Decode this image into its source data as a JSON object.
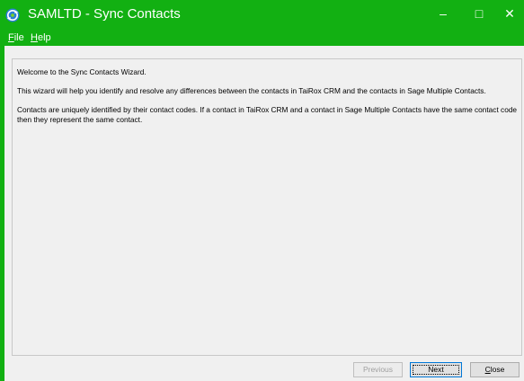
{
  "window": {
    "title": "SAMLTD - Sync Contacts",
    "icon": "sync-app-icon",
    "controls": {
      "minimize": "–",
      "maximize": "□",
      "close": "✕"
    },
    "accent_color": "#12b012"
  },
  "menu": {
    "file": {
      "mnemonic": "F",
      "rest": "ile"
    },
    "help": {
      "mnemonic": "H",
      "rest": "elp"
    }
  },
  "wizard": {
    "paragraphs": [
      "Welcome to the Sync Contacts Wizard.",
      "This wizard will help you identify and resolve any differences between the contacts in TaiRox CRM and the contacts in Sage Multiple Contacts.",
      "Contacts are uniquely identified by their contact codes. If a contact in TaiRox CRM and a contact in Sage Multiple Contacts have the same contact code then they represent the same contact."
    ]
  },
  "buttons": {
    "previous": "Previous",
    "next": "Next",
    "close": {
      "mnemonic": "C",
      "rest": "lose"
    }
  }
}
